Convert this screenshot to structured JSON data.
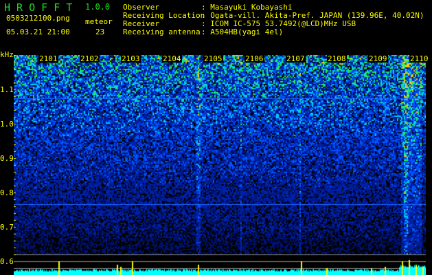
{
  "app": {
    "name": "H R O F F T",
    "version": "1.0.0"
  },
  "file": {
    "name": "0503212100.png",
    "datetime": "05.03.21 21:00"
  },
  "meteor": {
    "label": "meteor",
    "count": "23"
  },
  "info": [
    {
      "label": "Observer",
      "value": ": Masayuki Kobayashi"
    },
    {
      "label": "Receiving Location",
      "value": ": Ogata-vill. Akita-Pref. JAPAN (139.96E, 40.02N)"
    },
    {
      "label": "Receiver",
      "value": ": ICOM IC-575 53.7492(@LCD)MHz USB"
    },
    {
      "label": "Receiving antenna",
      "value": ": A504HB(yagi 4el)"
    }
  ],
  "axis": {
    "unit": "kHz",
    "yticks": [
      "1.1",
      "1.0",
      "0.9",
      "0.8",
      "0.7",
      "0.6"
    ],
    "minutes": [
      "2101",
      "2102",
      "2103",
      "2104",
      "2105",
      "2106",
      "2107",
      "2108",
      "2109",
      "2110"
    ]
  },
  "colors": {
    "text": "#ffff00",
    "title": "#22dd22",
    "histogram": "#00ffff",
    "meteor": "#ffff00"
  }
}
